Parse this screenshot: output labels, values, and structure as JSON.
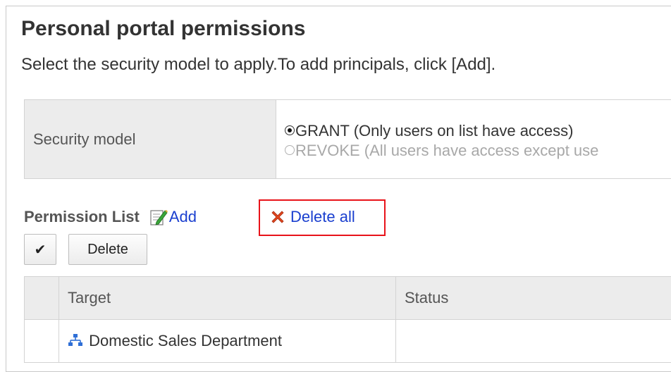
{
  "page": {
    "title": "Personal portal permissions",
    "description": "Select the security model to apply.To add principals, click [Add]."
  },
  "security": {
    "label": "Security model",
    "options": [
      {
        "label": "GRANT (Only users on list have access)",
        "checked": true,
        "disabled": false
      },
      {
        "label": "REVOKE (All users have access except use",
        "checked": false,
        "disabled": true
      }
    ]
  },
  "permission_list": {
    "title": "Permission List",
    "add_label": "Add",
    "delete_all_label": "Delete all",
    "check_button_label": "✔",
    "delete_button_label": "Delete",
    "columns": [
      "",
      "Target",
      "Status"
    ],
    "rows": [
      {
        "target": "Domestic Sales Department",
        "status": "",
        "icon": "organization-icon"
      }
    ]
  },
  "colors": {
    "link": "#1a3fcf",
    "highlight": "#e8131a",
    "header_bg": "#ececec"
  },
  "icons": {
    "add": "edit-add-icon",
    "delete_all": "red-x-icon",
    "org": "organization-icon"
  }
}
